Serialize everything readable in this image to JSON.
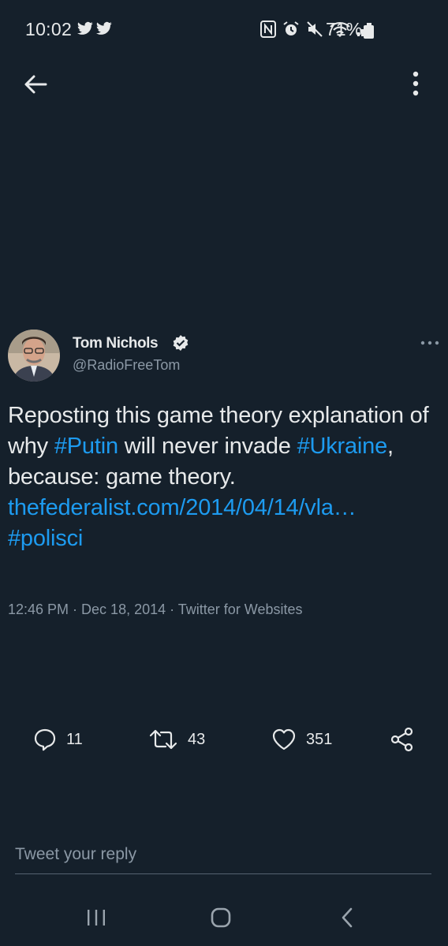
{
  "status_bar": {
    "time": "10:02",
    "battery_percent": "71%"
  },
  "toolbar": {
    "back_icon": "arrow-left-icon",
    "menu_icon": "vertical-dots-icon"
  },
  "tweet": {
    "author_name": "Tom Nichols",
    "handle": "@RadioFreeTom",
    "verified": true,
    "text_segments": [
      {
        "text": "Reposting this game theory explanation of why ",
        "type": "text"
      },
      {
        "text": "#Putin",
        "type": "hashtag"
      },
      {
        "text": " will never invade ",
        "type": "text"
      },
      {
        "text": "#Ukraine",
        "type": "hashtag"
      },
      {
        "text": ", because: game theory.",
        "type": "text"
      },
      {
        "text": "thefederalist.com/2014/04/14/vla…",
        "type": "url"
      },
      {
        "text": "#polisci",
        "type": "hashtag"
      }
    ],
    "time": "12:46 PM",
    "separator": " · ",
    "date": "Dec 18, 2014",
    "source": "Twitter for Websites"
  },
  "actions": {
    "replies": "11",
    "retweets": "43",
    "likes": "351"
  },
  "reply_box": {
    "placeholder": "Tweet your reply"
  },
  "colors": {
    "background": "#15202b",
    "link": "#1d9bf0",
    "muted": "#8b98a5"
  }
}
